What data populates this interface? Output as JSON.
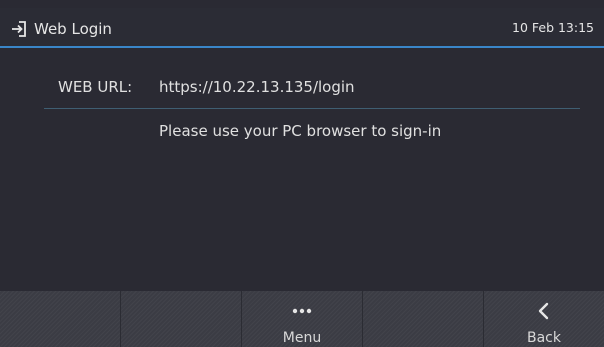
{
  "header": {
    "title": "Web Login",
    "icon": "login-icon",
    "clock": "10 Feb 13:15",
    "accent_color": "#3a86c8"
  },
  "content": {
    "url_label": "WEB URL:",
    "url_value": "https://10.22.13.135/login",
    "hint": "Please use your PC browser to sign-in"
  },
  "softkeys": [
    {
      "label": "",
      "icon": ""
    },
    {
      "label": "",
      "icon": ""
    },
    {
      "label": "Menu",
      "icon": "more-dots-icon"
    },
    {
      "label": "",
      "icon": ""
    },
    {
      "label": "Back",
      "icon": "chevron-left-icon"
    }
  ]
}
